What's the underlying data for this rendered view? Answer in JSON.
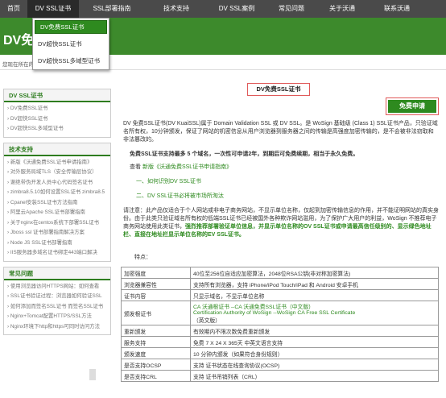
{
  "nav": {
    "items": [
      "首页",
      "DV SSL证书",
      "SSL部署指南",
      "技术支持",
      "DV SSL案例",
      "常见问题",
      "关于沃通",
      "联系沃通"
    ]
  },
  "band": {
    "logo_text": "DV免费"
  },
  "dropdown": {
    "items": [
      "DV免费SSL证书",
      "DV超快SSL证书",
      "DV超快SSL多域型证书"
    ]
  },
  "breadcrumb": "您现在所在的位置：",
  "sidebar": {
    "dv_title": "DV SSL证书",
    "dv_links": [
      "DV免费SSL证书",
      "DV超快SSL证书",
      "DV超快SSL多域型证书"
    ],
    "tech_title": "技术支持",
    "tech_links": [
      "新版《沃通免费SSL证书申请指南》",
      "对外服务局域TLS（安全传输层协议）",
      "谢绝带伪开发人员中心代码签名证书",
      "zimbra8.5.10如何设置SSL证书 zimbra8.5",
      "Cpanel安装SSL证书方法指南",
      "阿里云Apache SSL证书部署指南",
      "关于nginx在centos系统下部署SSL证书",
      "Jboss ssl 证书部署指南解决方案",
      "Node JS SSL证书部署指南",
      "IIS服务器多域名证书绑定443端口解决"
    ],
    "faq_title": "常见问题",
    "faq_links": [
      "使用浏览器访问HTTPS网站：如何查看",
      "SSL证书验证过程：浏览器如何验证SSL",
      "如何添加而签名SSL证书 而签名SSL证书",
      "Nginx+Tomcat配置HTTPS/SSL方法",
      "Nginx环境下http和https可同时访问方法"
    ]
  },
  "main": {
    "title": "DV免费SSL证书",
    "apply_button": "免费申请",
    "intro": "DV 免费SSL证书(DV KuaiSSL)属于 Domain Validation SSL 或 DV SSL。是 WoSign 基础级 (Class 1) SSL证书产品，只验证域名所有权，10分钟颁发，保证了网站的机密信息从用户浏览器到服务器之间的传输是高强度加密传输的，是不会被非法窃取和非法篡改的。",
    "free_line": "免费SSL证书支持最多 5 个域名，一次性可申请2年，到期后可免费续期，相当于永久免费。",
    "guide_prefix": "查看 ",
    "guide_link": "新版《沃通免费SSL证书申请指南》",
    "link1": "一、如何识别DV SSL证书",
    "link2": "二、DV SSL证书必将被市场所淘汰",
    "notice_a": "请注意：此产品仅适合于个人网站或非电子商务网站，不显示单位名称，仅起到加密传输信息的作用，并不能证明网站的真实身份。由于此类只验证域名所有权的低端SSL证书已经被国外各种欺诈网站滥用，为了保护广大用户的利益，WoSign 不推荐电子商务网站使用此类证书，",
    "notice_b": "强烈推荐部署验证单位信息，并显示单位名称的OV SSL证书或申请最高信任级别的、显示绿色地址栏、直接在地址栏显示单位名称的EV SSL证书。",
    "features_label": "特点：",
    "features": [
      {
        "label": "加密强度",
        "value": "40位至256位自适应加密算法，2048位RSA公钥(非对称加密算法)"
      },
      {
        "label": "浏览器兼容性",
        "value": "支持所有浏览器，支持 iPhone/iPod Touch/iPad 和 Android 安卓手机"
      },
      {
        "label": "证书内容",
        "value": "只显示域名，不显示单位名称"
      },
      {
        "label": "颁发根证书",
        "value_lines": [
          "CA 沃通根证书 --CA 沃通免费SSL证书（中文版）",
          "Certification Authority of WoSign --WoSign CA Free SSL Certificate",
          "（英文版）"
        ]
      },
      {
        "label": "重新颁发",
        "value": "有效期内不限次数免费重新颁发"
      },
      {
        "label": "服务支持",
        "value": "免费 7 X 24 X 365天 中英文语言支持"
      },
      {
        "label": "颁发速度",
        "value": "10 分钟内颁发（如果符合身份规则）"
      },
      {
        "label": "是否支持OCSP",
        "value": "支持 证书状态在线查询协议(OCSP)"
      },
      {
        "label": "是否支持CRL",
        "value": "支持 证书吊销列表（CRL）"
      }
    ]
  },
  "colors": {
    "brand_green": "#2e8a1f",
    "nav_bg": "#4a4a4a",
    "highlight_red": "#e05a5a"
  }
}
